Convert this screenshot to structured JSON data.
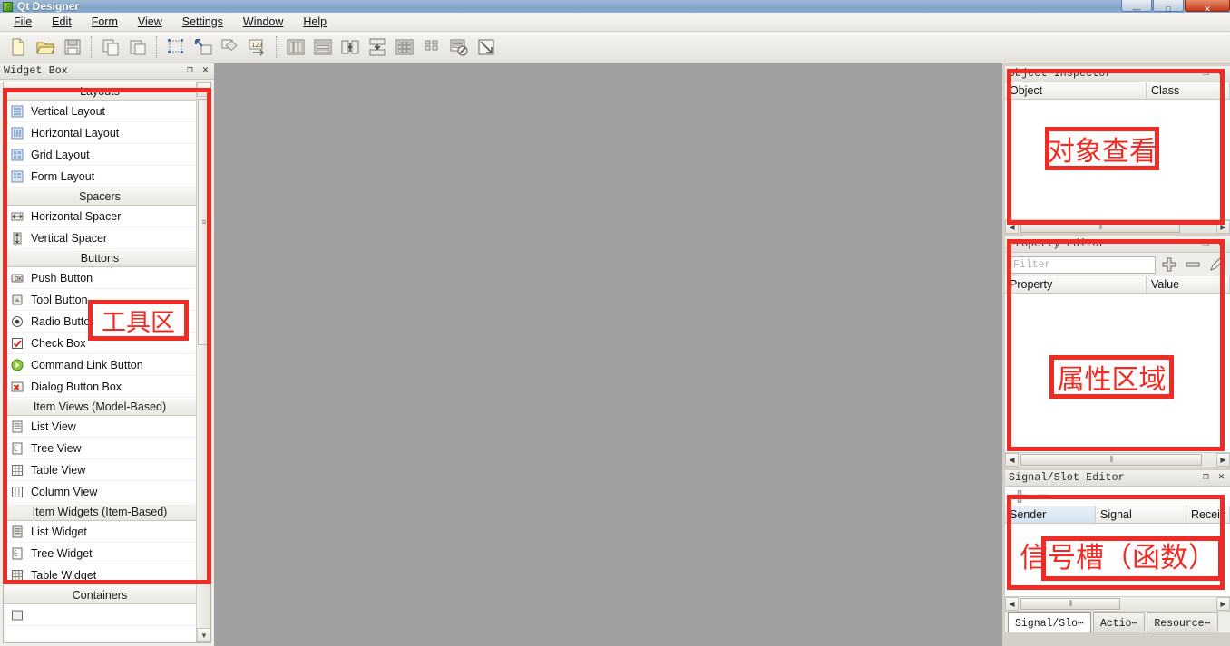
{
  "window": {
    "title": "Qt Designer",
    "app_icon": "qt-designer-icon",
    "controls": [
      {
        "name": "minimize-button",
        "glyph": "—"
      },
      {
        "name": "maximize-button",
        "glyph": "□"
      },
      {
        "name": "close-button",
        "glyph": "✕"
      }
    ]
  },
  "menubar": {
    "items": [
      {
        "label": "File",
        "accel": "F"
      },
      {
        "label": "Edit",
        "accel": "E"
      },
      {
        "label": "Form",
        "accel": "o"
      },
      {
        "label": "View",
        "accel": "V"
      },
      {
        "label": "Settings",
        "accel": "S"
      },
      {
        "label": "Window",
        "accel": "W"
      },
      {
        "label": "Help",
        "accel": "H"
      }
    ]
  },
  "toolbar": {
    "groups": [
      {
        "name": "file-group",
        "items": [
          {
            "icon": "new-form-icon",
            "label": "New"
          },
          {
            "icon": "open-form-icon",
            "label": "Open"
          },
          {
            "icon": "save-form-icon",
            "label": "Save"
          }
        ]
      },
      {
        "name": "edit-group",
        "items": [
          {
            "icon": "copy-icon",
            "label": "Copy"
          },
          {
            "icon": "paste-icon",
            "label": "Paste"
          }
        ]
      },
      {
        "name": "mode-group",
        "items": [
          {
            "icon": "edit-widgets-icon",
            "label": "Edit Widgets"
          },
          {
            "icon": "edit-signals-icon",
            "label": "Edit Signals/Slots"
          },
          {
            "icon": "edit-buddies-icon",
            "label": "Edit Buddies"
          },
          {
            "icon": "edit-taborder-icon",
            "label": "Edit Tab Order"
          }
        ]
      },
      {
        "name": "layout-group",
        "items": [
          {
            "icon": "layout-horizontal-icon",
            "label": "Lay Out Horizontally"
          },
          {
            "icon": "layout-vertical-icon",
            "label": "Lay Out Vertically"
          },
          {
            "icon": "layout-hsplitter-icon",
            "label": "Lay Out in a Splitter Horizontally"
          },
          {
            "icon": "layout-vsplitter-icon",
            "label": "Lay Out in a Splitter Vertically"
          },
          {
            "icon": "layout-grid-icon",
            "label": "Lay Out in a Grid"
          },
          {
            "icon": "layout-form-icon",
            "label": "Lay Out in a Form Layout"
          },
          {
            "icon": "break-layout-icon",
            "label": "Break Layout"
          },
          {
            "icon": "adjust-size-icon",
            "label": "Adjust Size"
          }
        ]
      }
    ]
  },
  "widget_box": {
    "title": "Widget Box",
    "titlebar_buttons": [
      {
        "name": "float-button",
        "glyph": "❐"
      },
      {
        "name": "close-button",
        "glyph": "✕"
      }
    ],
    "scroll": {
      "up_glyph": "▲",
      "down_glyph": "▼"
    },
    "sections": [
      {
        "group": "Layouts",
        "items": [
          {
            "label": "Vertical Layout",
            "icon": "vertical-layout-icon"
          },
          {
            "label": "Horizontal Layout",
            "icon": "horizontal-layout-icon"
          },
          {
            "label": "Grid Layout",
            "icon": "grid-layout-icon"
          },
          {
            "label": "Form Layout",
            "icon": "form-layout-icon"
          }
        ]
      },
      {
        "group": "Spacers",
        "items": [
          {
            "label": "Horizontal Spacer",
            "icon": "horizontal-spacer-icon"
          },
          {
            "label": "Vertical Spacer",
            "icon": "vertical-spacer-icon"
          }
        ]
      },
      {
        "group": "Buttons",
        "items": [
          {
            "label": "Push Button",
            "icon": "push-button-icon"
          },
          {
            "label": "Tool Button",
            "icon": "tool-button-icon"
          },
          {
            "label": "Radio Button",
            "icon": "radio-button-icon"
          },
          {
            "label": "Check Box",
            "icon": "check-box-icon"
          },
          {
            "label": "Command Link Button",
            "icon": "command-link-button-icon"
          },
          {
            "label": "Dialog Button Box",
            "icon": "dialog-button-box-icon"
          }
        ]
      },
      {
        "group": "Item Views (Model-Based)",
        "items": [
          {
            "label": "List View",
            "icon": "list-view-icon"
          },
          {
            "label": "Tree View",
            "icon": "tree-view-icon"
          },
          {
            "label": "Table View",
            "icon": "table-view-icon"
          },
          {
            "label": "Column View",
            "icon": "column-view-icon"
          }
        ]
      },
      {
        "group": "Item Widgets (Item-Based)",
        "items": [
          {
            "label": "List Widget",
            "icon": "list-widget-icon"
          },
          {
            "label": "Tree Widget",
            "icon": "tree-widget-icon"
          },
          {
            "label": "Table Widget",
            "icon": "table-widget-icon"
          }
        ]
      },
      {
        "group": "Containers",
        "items": []
      }
    ]
  },
  "object_inspector": {
    "title": "Object Inspector",
    "titlebar_buttons": [
      {
        "name": "float-button",
        "glyph": "❐"
      },
      {
        "name": "close-button",
        "glyph": "✕"
      }
    ],
    "columns": [
      "Object",
      "Class"
    ],
    "rows": [],
    "scroll": {
      "left_glyph": "◀",
      "right_glyph": "▶"
    }
  },
  "property_editor": {
    "title": "Property Editor",
    "titlebar_buttons": [
      {
        "name": "float-button",
        "glyph": "❐"
      },
      {
        "name": "close-button",
        "glyph": "✕"
      }
    ],
    "filter": {
      "value": "",
      "placeholder": "Filter"
    },
    "tool_buttons": [
      {
        "name": "add-property-button",
        "icon": "plus-icon"
      },
      {
        "name": "remove-property-button",
        "icon": "minus-icon"
      },
      {
        "name": "configure-button",
        "icon": "pencil-icon"
      }
    ],
    "columns": [
      "Property",
      "Value"
    ],
    "rows": [],
    "scroll": {
      "left_glyph": "◀",
      "right_glyph": "▶"
    }
  },
  "signal_slot_editor": {
    "title": "Signal/Slot Editor",
    "titlebar_buttons": [
      {
        "name": "float-button",
        "glyph": "❐"
      },
      {
        "name": "close-button",
        "glyph": "✕"
      }
    ],
    "tool_buttons": [
      {
        "name": "add-connection-button",
        "icon": "plus-icon"
      },
      {
        "name": "remove-connection-button",
        "icon": "minus-icon"
      }
    ],
    "columns": [
      "Sender",
      "Signal",
      "Receiv"
    ],
    "rows": [],
    "scroll": {
      "left_glyph": "◀",
      "right_glyph": "▶"
    }
  },
  "bottom_tabs": {
    "items": [
      {
        "label": "Signal/Slo⋯",
        "active": true
      },
      {
        "label": "Actio⋯",
        "active": false
      },
      {
        "label": "Resource⋯",
        "active": false
      }
    ]
  },
  "annotations": {
    "accent_color": "#ee2b24",
    "items": [
      {
        "name": "annotation-tool-area",
        "text": "工具区"
      },
      {
        "name": "annotation-object-view",
        "text": "对象查看"
      },
      {
        "name": "annotation-property-area",
        "text": "属性区域"
      },
      {
        "name": "annotation-signal-slot-func",
        "text": "信号槽（函数）"
      }
    ]
  }
}
